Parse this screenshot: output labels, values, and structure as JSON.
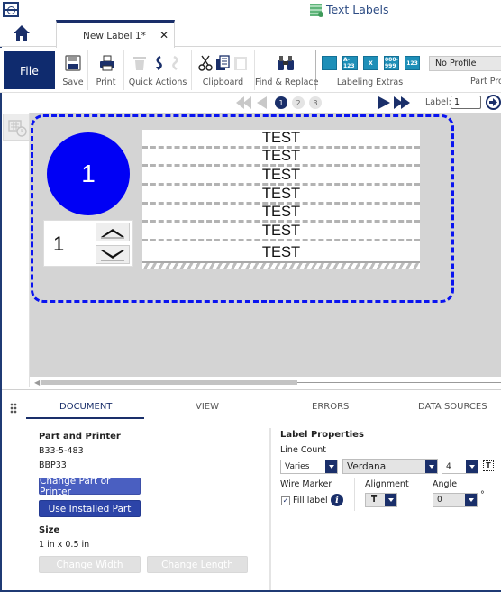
{
  "app": {
    "title": "Text Labels",
    "document_tab": "New Label 1*",
    "close_glyph": "✕"
  },
  "ribbon": {
    "file_label": "File",
    "groups": {
      "save": "Save",
      "print": "Print",
      "quick_actions": "Quick Actions",
      "clipboard": "Clipboard",
      "find_replace": "Find & Replace",
      "labeling_extras": "Labeling Extras",
      "part_profile": "Part Profile"
    },
    "labeling_extras_icons": [
      "database-icon",
      "sequence-icon",
      "excel-import-icon",
      "serial-icon",
      "numbering-icon"
    ],
    "labeling_extras_glyphs": [
      "",
      "A-123",
      "X",
      "000-999",
      "123"
    ],
    "profile_select": "No Profile"
  },
  "navigation": {
    "pages": [
      "1",
      "2",
      "3"
    ],
    "current_page": "1",
    "label_field_caption": "Label:",
    "label_field_value": "1"
  },
  "canvas": {
    "circle_number": "1",
    "stepper_value": "1",
    "text_lines": [
      "TEST",
      "TEST",
      "TEST",
      "TEST",
      "TEST",
      "TEST",
      "TEST"
    ],
    "colors": {
      "outline": "#0a14f0",
      "circle": "#0000f5"
    }
  },
  "panel": {
    "tabs": [
      "DOCUMENT",
      "VIEW",
      "ERRORS",
      "DATA SOURCES"
    ],
    "active_tab": "DOCUMENT",
    "document": {
      "part_and_printer_title": "Part and Printer",
      "part_number": "B33-5-483",
      "printer": "BBP33",
      "change_part_button": "Change Part or Printer",
      "use_installed_button": "Use Installed Part",
      "size_title": "Size",
      "size_value": "1 in x 0.5 in",
      "change_width_button": "Change Width",
      "change_length_button": "Change Length"
    },
    "label_properties": {
      "title": "Label Properties",
      "line_count_label": "Line Count",
      "line_count_value": "Varies",
      "font_value": "Verdana",
      "font_size_value": "4",
      "wire_marker_label": "Wire Marker",
      "fill_label_text": "Fill label",
      "fill_label_checked": true,
      "check_glyph": "✓",
      "alignment_label": "Alignment",
      "alignment_glyph": "T",
      "angle_label": "Angle",
      "angle_value": "0",
      "degree_symbol": "°",
      "info_glyph": "i"
    }
  }
}
